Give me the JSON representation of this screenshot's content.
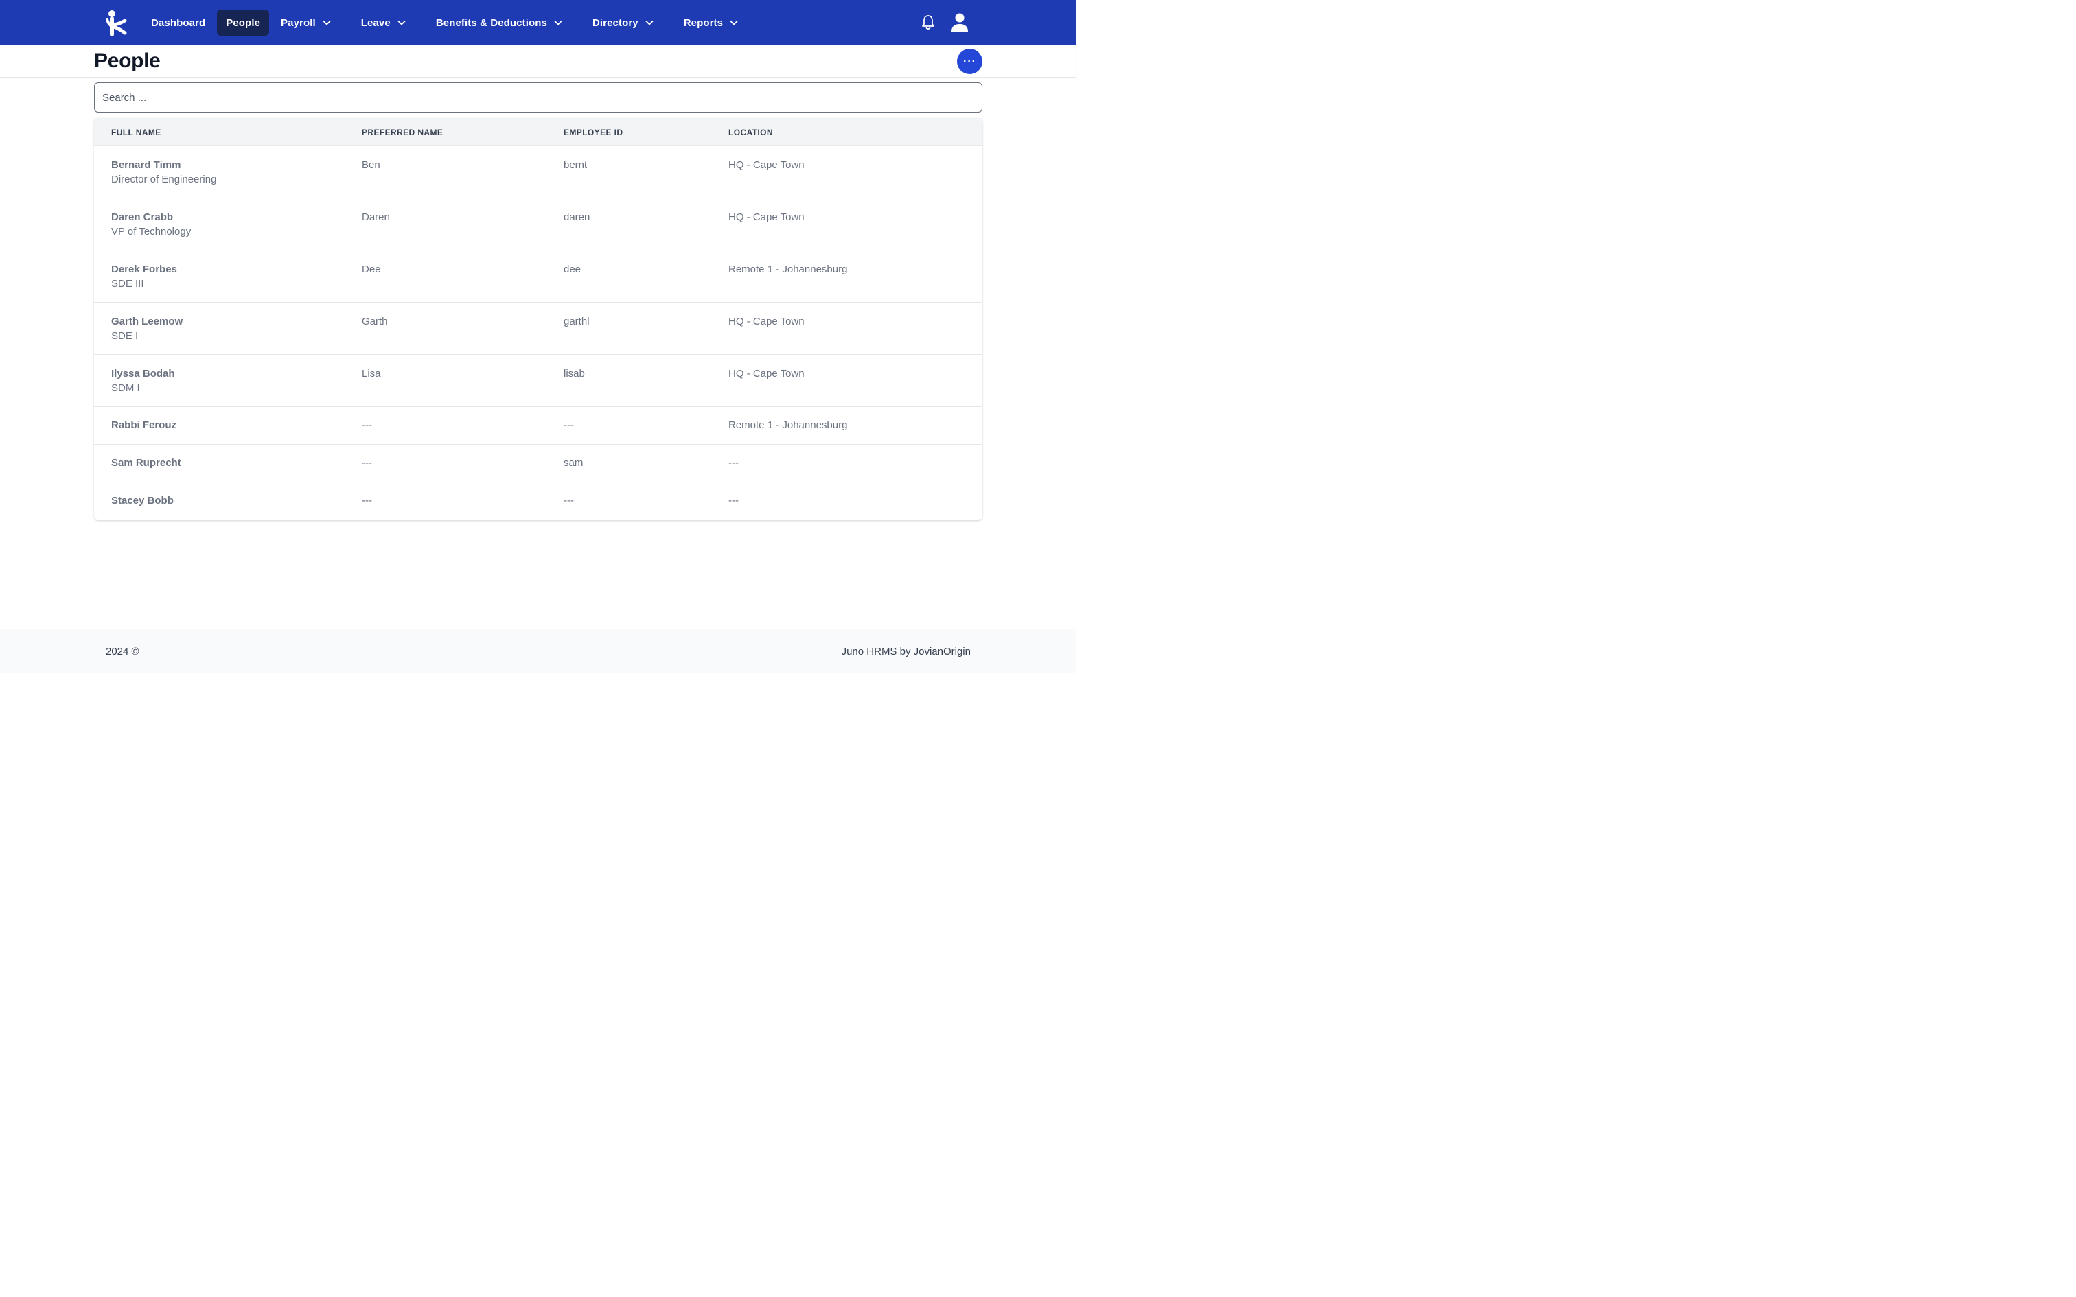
{
  "nav": {
    "items": [
      {
        "label": "Dashboard"
      },
      {
        "label": "People"
      },
      {
        "label": "Payroll"
      },
      {
        "label": "Leave"
      },
      {
        "label": "Benefits & Deductions"
      },
      {
        "label": "Directory"
      },
      {
        "label": "Reports"
      }
    ],
    "active": "People",
    "icons": {
      "logo": "juno-logo-icon",
      "notifications": "bell-icon",
      "profile": "user-icon"
    }
  },
  "header": {
    "title": "People",
    "more_label": "···"
  },
  "search": {
    "placeholder": "Search ...",
    "value": ""
  },
  "table": {
    "columns": [
      "FULL NAME",
      "PREFERRED NAME",
      "EMPLOYEE ID",
      "LOCATION"
    ],
    "rows": [
      {
        "name": "Bernard Timm",
        "title": "Director of Engineering",
        "preferred": "Ben",
        "id": "bernt",
        "location": "HQ - Cape Town"
      },
      {
        "name": "Daren Crabb",
        "title": "VP of Technology",
        "preferred": "Daren",
        "id": "daren",
        "location": "HQ - Cape Town"
      },
      {
        "name": "Derek Forbes",
        "title": "SDE III",
        "preferred": "Dee",
        "id": "dee",
        "location": "Remote 1 - Johannesburg"
      },
      {
        "name": "Garth Leemow",
        "title": "SDE I",
        "preferred": "Garth",
        "id": "garthl",
        "location": "HQ - Cape Town"
      },
      {
        "name": "Ilyssa Bodah",
        "title": "SDM I",
        "preferred": "Lisa",
        "id": "lisab",
        "location": "HQ - Cape Town"
      },
      {
        "name": "Rabbi Ferouz",
        "title": "",
        "preferred": "---",
        "id": "---",
        "location": "Remote 1 - Johannesburg"
      },
      {
        "name": "Sam Ruprecht",
        "title": "",
        "preferred": "---",
        "id": "sam",
        "location": "---"
      },
      {
        "name": "Stacey Bobb",
        "title": "",
        "preferred": "---",
        "id": "---",
        "location": "---"
      }
    ]
  },
  "footer": {
    "left": "2024 ©",
    "right": "Juno HRMS by JovianOrigin"
  },
  "colors": {
    "nav_bg": "#1e3bb3",
    "nav_active": "#172554",
    "accent": "#2547d8"
  }
}
